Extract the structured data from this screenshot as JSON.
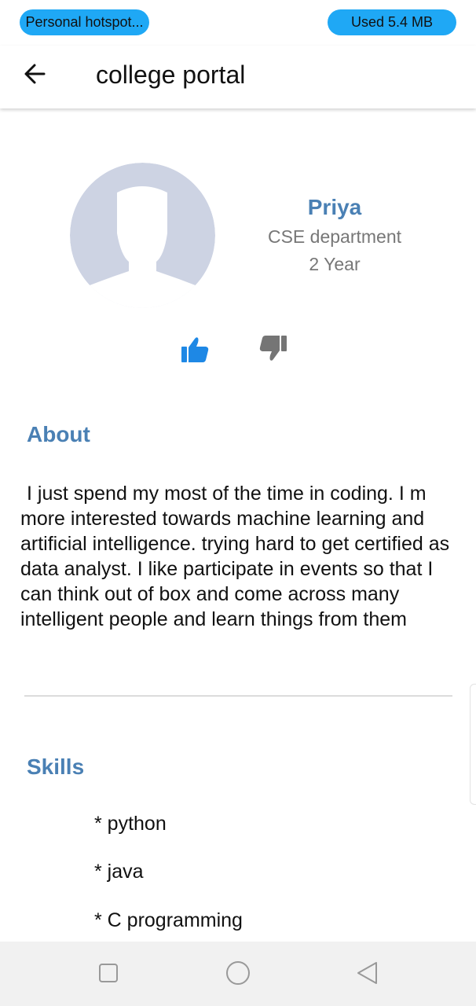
{
  "status_bar": {
    "hotspot_label": "Personal hotspot...",
    "data_usage_label": "Used  5.4 MB"
  },
  "app_bar": {
    "title": "college portal",
    "back_icon": "arrow-left-icon"
  },
  "profile": {
    "avatar_icon": "default-avatar-silhouette",
    "name": "Priya",
    "department": "CSE department",
    "year": "2 Year",
    "like_icon": "thumbs-up-icon",
    "dislike_icon": "thumbs-down-icon"
  },
  "about": {
    "title": "About",
    "text": "I just spend my most of the time in coding. I m more interested towards machine learning and artificial intelligence. trying hard to get certified as data analyst. I like participate in events so that I can think out of box and come across many intelligent people and learn things from them"
  },
  "skills": {
    "title": "Skills",
    "items": [
      "* python",
      "* java",
      "* C programming"
    ]
  },
  "nav_bar": {
    "recent_icon": "square-icon",
    "home_icon": "circle-icon",
    "back_icon": "triangle-back-icon"
  },
  "colors": {
    "accent": "#4a80b4",
    "pill": "#1fa8f5",
    "like": "#1e88e5",
    "dislike": "#757575",
    "avatar": "#cdd3e3"
  }
}
